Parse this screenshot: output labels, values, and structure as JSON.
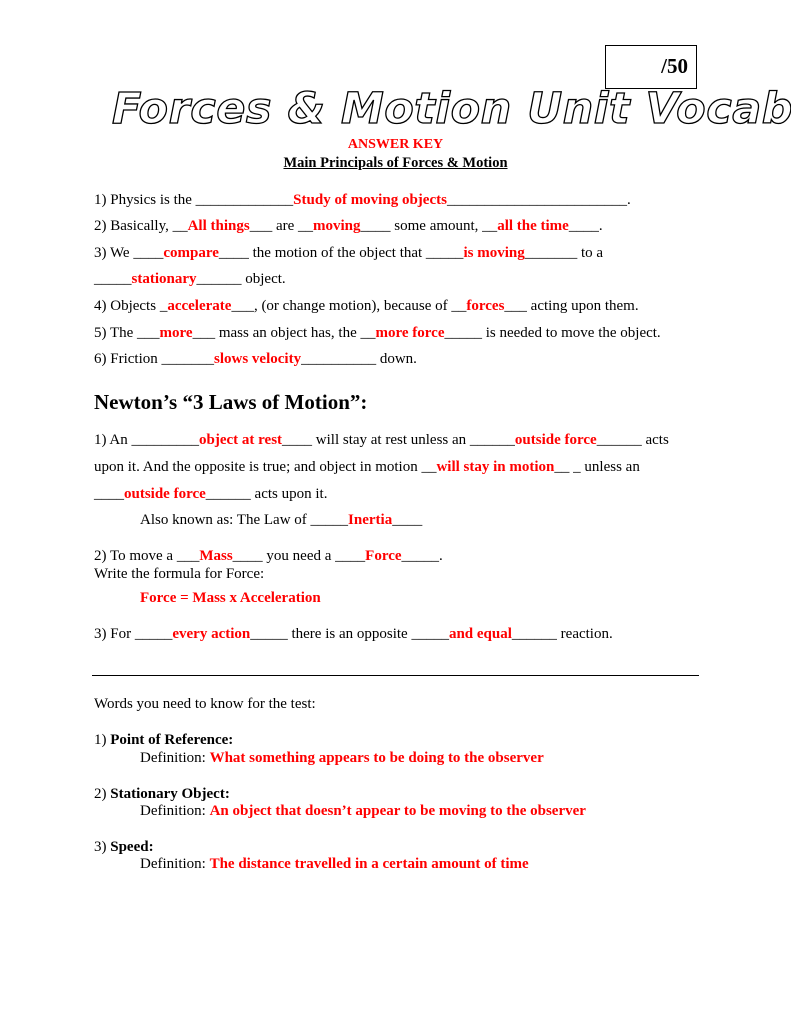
{
  "score": {
    "label": "/50"
  },
  "title": "Forces & Motion Unit Vocabulary",
  "answer_key": "ANSWER KEY",
  "subtitle": "Main Principals of Forces & Motion",
  "colors": {
    "answer": "#ff0000",
    "text": "#000000"
  },
  "principles": [
    {
      "parts": [
        {
          "t": "1) Physics is the _____________"
        },
        {
          "a": "Study of moving objects"
        },
        {
          "t": "________________________."
        }
      ]
    },
    {
      "parts": [
        {
          "t": "2) Basically, __"
        },
        {
          "a": "All things"
        },
        {
          "t": "___ are __"
        },
        {
          "a": "moving"
        },
        {
          "t": "____ some amount, __"
        },
        {
          "a": "all the time"
        },
        {
          "t": "____."
        }
      ]
    },
    {
      "parts": [
        {
          "t": "3) We ____"
        },
        {
          "a": "compare"
        },
        {
          "t": "____ the motion of the object that _____"
        },
        {
          "a": "is moving"
        },
        {
          "t": "_______ to a"
        }
      ]
    },
    {
      "parts": [
        {
          "t": "_____"
        },
        {
          "a": "stationary"
        },
        {
          "t": "______ object."
        }
      ]
    },
    {
      "parts": [
        {
          "t": "4) Objects _"
        },
        {
          "a": "accelerate"
        },
        {
          "t": "___, (or change motion), because of __"
        },
        {
          "a": "forces"
        },
        {
          "t": "___ acting upon them."
        }
      ]
    },
    {
      "parts": [
        {
          "t": "5) The ___"
        },
        {
          "a": "more"
        },
        {
          "t": "___ mass an object has, the __"
        },
        {
          "a": "more force"
        },
        {
          "t": "_____ is needed to move the object."
        }
      ]
    },
    {
      "parts": [
        {
          "t": "6) Friction _______"
        },
        {
          "a": "slows velocity"
        },
        {
          "t": "__________ down."
        }
      ]
    }
  ],
  "newton_heading": "Newton’s “3 Laws of Motion”:",
  "newton": [
    {
      "parts": [
        {
          "t": "1) An _________"
        },
        {
          "a": "object at rest"
        },
        {
          "t": "____ will stay at rest unless an ______"
        },
        {
          "a": "outside force"
        },
        {
          "t": "______ acts"
        }
      ]
    },
    {
      "parts": [
        {
          "t": "upon it. And the opposite is true; and object in motion __"
        },
        {
          "a": "will stay in motion"
        },
        {
          "t": "__ _ unless an"
        }
      ]
    },
    {
      "parts": [
        {
          "t": "____"
        },
        {
          "a": "outside force"
        },
        {
          "t": "______ acts upon it."
        }
      ]
    },
    {
      "parts": [
        {
          "t": "Also known as: The Law of _____"
        },
        {
          "a": "Inertia"
        },
        {
          "t": "____"
        }
      ]
    },
    {
      "parts": [
        {
          "t": "2) To move a ___"
        },
        {
          "a": "Mass"
        },
        {
          "t": "____ you need a ____"
        },
        {
          "a": "Force"
        },
        {
          "t": "_____."
        }
      ]
    },
    {
      "parts": [
        {
          "t": "Write the formula for Force:"
        }
      ]
    },
    {
      "parts": [
        {
          "a": "Force = Mass x Acceleration"
        }
      ]
    },
    {
      "parts": [
        {
          "t": "3) For _____"
        },
        {
          "a": "every action"
        },
        {
          "t": "_____ there is an opposite _____"
        },
        {
          "a": "and equal"
        },
        {
          "t": "______ reaction."
        }
      ]
    }
  ],
  "words_intro": "Words you need to know for the test:",
  "vocab": [
    {
      "num": "1) ",
      "term": "Point of Reference:",
      "def_label": "Definition: ",
      "definition": "What something appears to be doing to the observer"
    },
    {
      "num": "2) ",
      "term": "Stationary Object:",
      "def_label": "Definition: ",
      "definition": "An object that doesn’t appear to be moving to the observer"
    },
    {
      "num": "3) ",
      "term": "Speed:",
      "def_label": "Definition: ",
      "definition": "The distance travelled in a certain amount of time"
    }
  ]
}
